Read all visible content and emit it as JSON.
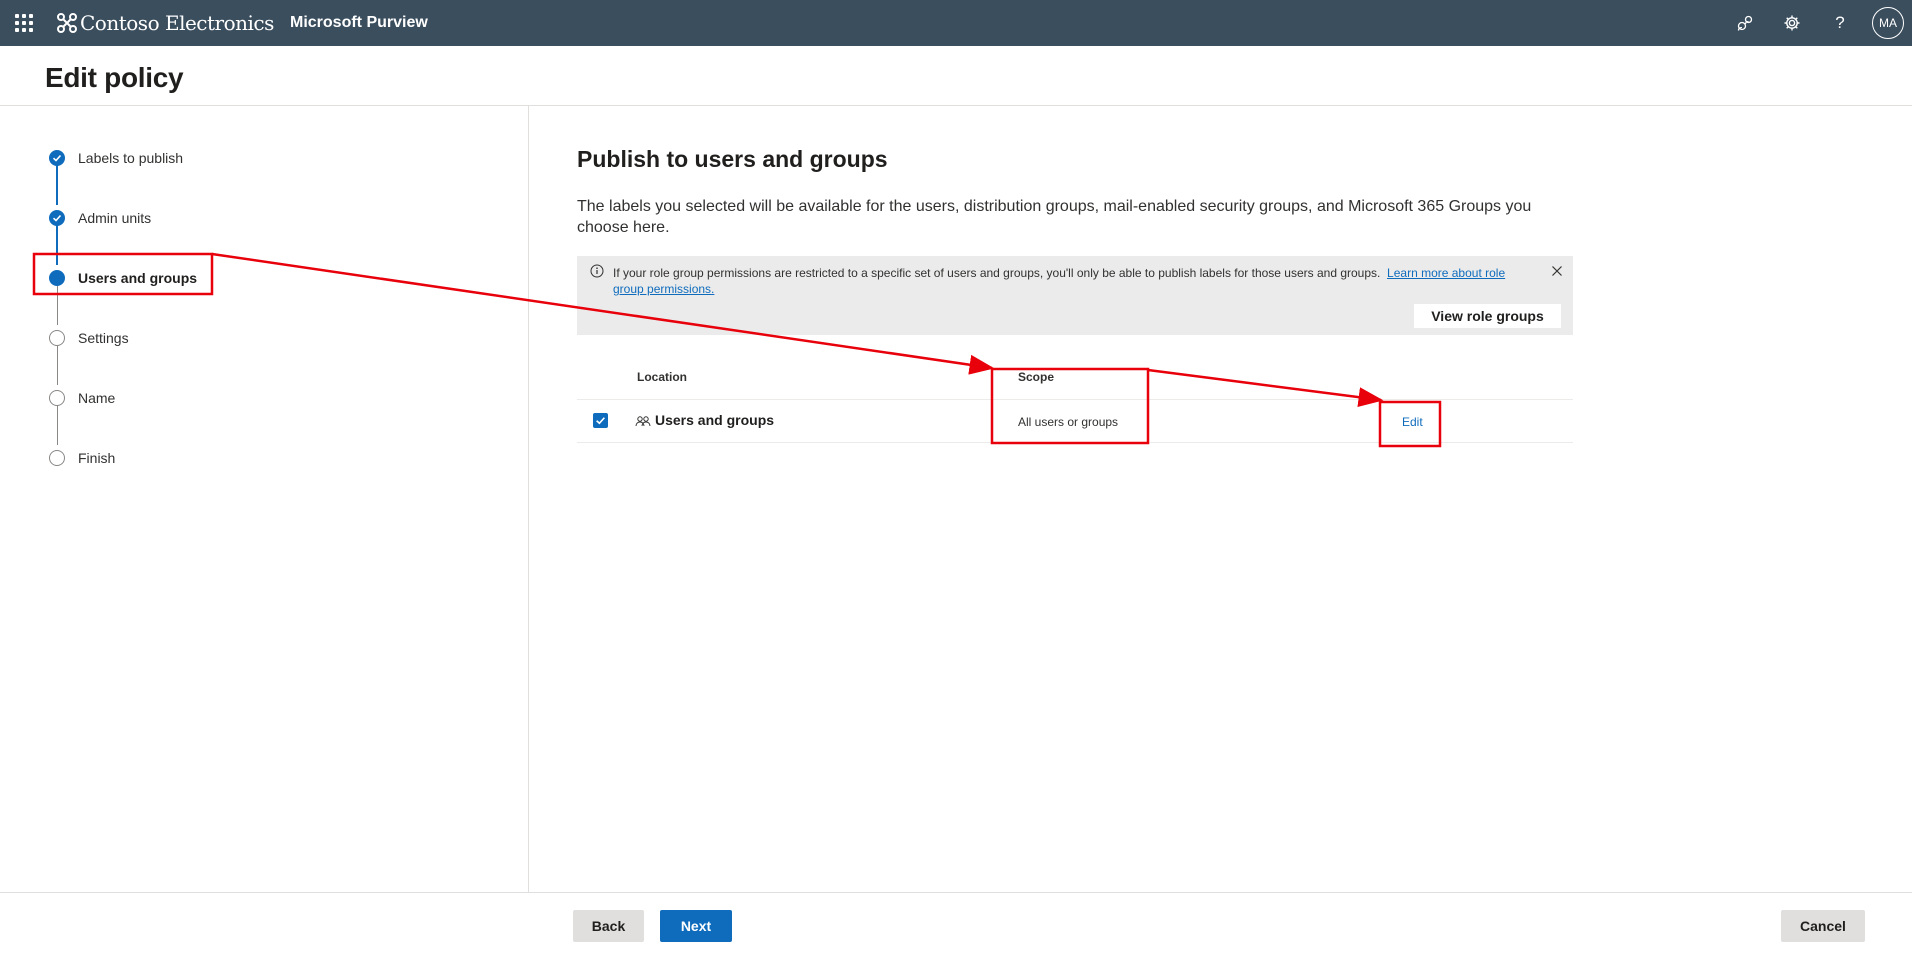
{
  "topbar": {
    "brand": "Contoso Electronics",
    "product": "Microsoft Purview",
    "avatar_initials": "MA",
    "icons": [
      "app-launcher-icon",
      "feedback-icon",
      "gear-icon",
      "help-icon"
    ]
  },
  "header": {
    "title": "Edit policy"
  },
  "steps": [
    {
      "label": "Labels to publish",
      "state": "done"
    },
    {
      "label": "Admin units",
      "state": "done"
    },
    {
      "label": "Users and groups",
      "state": "current"
    },
    {
      "label": "Settings",
      "state": "todo"
    },
    {
      "label": "Name",
      "state": "todo"
    },
    {
      "label": "Finish",
      "state": "todo"
    }
  ],
  "main": {
    "title": "Publish to users and groups",
    "description": "The labels you selected will be available for the users, distribution groups, mail-enabled security groups, and Microsoft 365 Groups you choose here.",
    "info": {
      "text": "If your role group permissions are restricted to a specific set of users and groups, you'll only be able to publish labels for those users and groups.",
      "link": "Learn more about role group permissions.",
      "button": "View role groups"
    },
    "table": {
      "columns": [
        "Location",
        "Scope"
      ],
      "rows": [
        {
          "checked": true,
          "location": "Users and groups",
          "scope": "All users or groups",
          "action": "Edit"
        }
      ]
    }
  },
  "footer": {
    "back": "Back",
    "next": "Next",
    "cancel": "Cancel"
  },
  "colors": {
    "topbar": "#3b4e5e",
    "accent": "#0f6cbd",
    "annotation": "#e8000b"
  }
}
